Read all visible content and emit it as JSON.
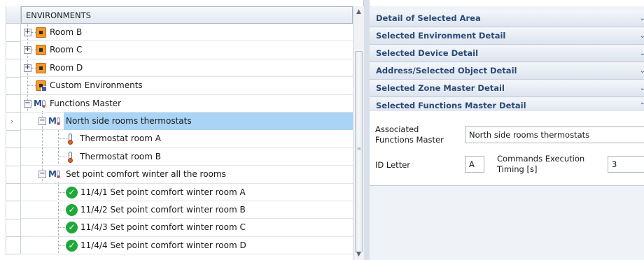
{
  "tree": {
    "header": "ENVIRONMENTS",
    "items": [
      {
        "label": "Room B"
      },
      {
        "label": "Room C"
      },
      {
        "label": "Room D"
      },
      {
        "label": "Custom Environments"
      },
      {
        "label": "Functions Master"
      },
      {
        "label": "North side rooms thermostats"
      },
      {
        "label": "Thermostat room A"
      },
      {
        "label": "Thermostat room B"
      },
      {
        "label": "Set point comfort winter all the rooms"
      },
      {
        "label": "11/4/1 Set point comfort winter room A"
      },
      {
        "label": "11/4/2 Set point comfort winter room B"
      },
      {
        "label": "11/4/3 Set point comfort winter room C"
      },
      {
        "label": "11/4/4 Set point comfort winter room D"
      }
    ],
    "selected_index": 5,
    "icons": {
      "expand": "+",
      "collapse": "−",
      "row_selector": "›",
      "check": "✓",
      "fm": "M"
    }
  },
  "scrollbar": {
    "up": "▲",
    "down": "▼",
    "grip": "≡"
  },
  "details": {
    "sections": [
      {
        "title": "Detail of Selected Area",
        "chev": "⌄"
      },
      {
        "title": "Selected Environment Detail",
        "chev": "⌄"
      },
      {
        "title": "Selected Device Detail",
        "chev": "⌄"
      },
      {
        "title": "Address/Selected Object Detail",
        "chev": "⌄"
      },
      {
        "title": "Selected Zone Master Detail",
        "chev": "⌄"
      },
      {
        "title": "Selected Functions Master Detail",
        "chev": "⌃"
      }
    ],
    "associated_label_1": "Associated",
    "associated_label_2": "Functions Master",
    "associated_value": "North side rooms thermostats",
    "id_letter_label": "ID Letter",
    "id_letter_value": "A",
    "timing_label_1": "Commands Execution",
    "timing_label_2": "Timing [s]",
    "timing_value": "3"
  },
  "colors": {
    "selection": "#a9d4f5",
    "section_text": "#2b4a78",
    "room_icon": "#f29a2e",
    "check": "#1fa83a"
  }
}
